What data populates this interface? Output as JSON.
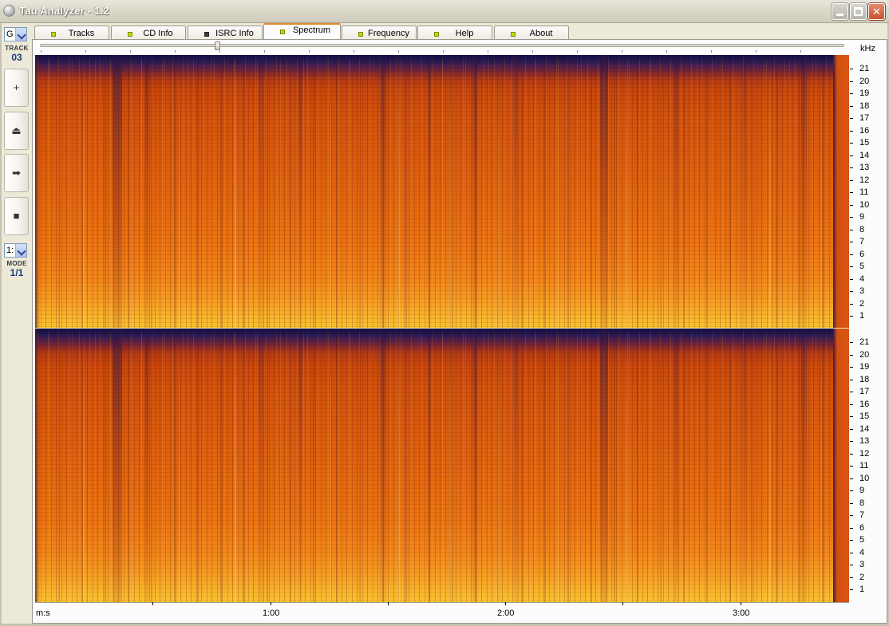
{
  "window": {
    "title": "Tau Analyzer - 1.2"
  },
  "sidebar": {
    "track_combo_value": "G",
    "track_caption": "TRACK",
    "track_number": "03",
    "buttons": [
      {
        "icon": "plus-icon",
        "glyph": "+"
      },
      {
        "icon": "eject-icon",
        "glyph": "⏏"
      },
      {
        "icon": "play-icon",
        "glyph": "➡"
      },
      {
        "icon": "stop-icon",
        "glyph": "■"
      }
    ],
    "mode_combo_value": "1:",
    "mode_caption": "MODE",
    "mode_value": "1/1"
  },
  "tabs": [
    {
      "label": "Tracks",
      "led": "on",
      "active": false
    },
    {
      "label": "CD Info",
      "led": "on",
      "active": false
    },
    {
      "label": "ISRC Info",
      "led": "off",
      "active": false
    },
    {
      "label": "Spectrum",
      "led": "on",
      "active": true
    },
    {
      "label": "Frequency",
      "led": "on",
      "active": false
    },
    {
      "label": "Help",
      "led": "on",
      "active": false
    },
    {
      "label": "About",
      "led": "on",
      "active": false
    }
  ],
  "spectrum": {
    "position_slider_fraction": 0.22,
    "frequency_unit": "kHz",
    "frequency_ticks": [
      "21",
      "20",
      "19",
      "18",
      "17",
      "16",
      "15",
      "14",
      "13",
      "12",
      "11",
      "10",
      "9",
      "8",
      "7",
      "6",
      "5",
      "4",
      "3",
      "2",
      "1"
    ],
    "time_axis_label": "m:s",
    "time_labels": [
      "1:00",
      "2:00",
      "3:00"
    ],
    "channels": [
      "left",
      "right"
    ],
    "colors": {
      "low": "#1e1852",
      "mid": "#dc5c0e",
      "high": "#fbc431"
    }
  }
}
